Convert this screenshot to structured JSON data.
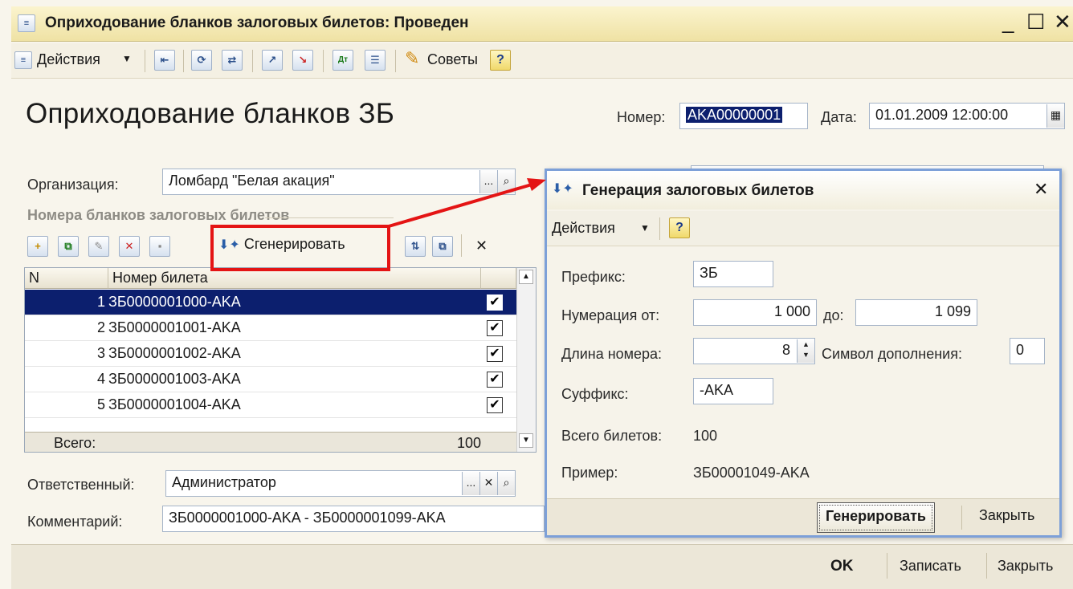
{
  "window": {
    "title": "Оприходование бланков залоговых билетов: Проведен",
    "minimize": "_",
    "maximize": "☐",
    "close": "✕"
  },
  "toolbar": {
    "actions_label": "Действия",
    "tips_label": "Советы",
    "help_label": "?"
  },
  "document": {
    "heading": "Оприходование бланков ЗБ",
    "number_label": "Номер:",
    "number_value": "AKA00000001",
    "date_label": "Дата:",
    "date_value": "01.01.2009 12:00:00",
    "org_label": "Организация:",
    "org_value": "Ломбард \"Белая акация\"",
    "group_title": "Номера бланков залоговых билетов",
    "generate_label": "Сгенерировать",
    "responsible_label": "Ответственный:",
    "responsible_value": "Администратор",
    "comment_label": "Комментарий:",
    "comment_value": "ЗБ0000001000-AKA - ЗБ0000001099-AKA"
  },
  "table": {
    "col_n": "N",
    "col_number": "Номер билета",
    "rows": [
      {
        "n": "1",
        "number": "ЗБ0000001000-AKA",
        "check": "✔"
      },
      {
        "n": "2",
        "number": "ЗБ0000001001-AKA",
        "check": "✔"
      },
      {
        "n": "3",
        "number": "ЗБ0000001002-AKA",
        "check": "✔"
      },
      {
        "n": "4",
        "number": "ЗБ0000001003-AKA",
        "check": "✔"
      },
      {
        "n": "5",
        "number": "ЗБ0000001004-AKA",
        "check": "✔"
      }
    ],
    "total_label": "Всего:",
    "total_value": "100"
  },
  "footer": {
    "ok": "OK",
    "save": "Записать",
    "close": "Закрыть"
  },
  "dialog": {
    "title": "Генерация залоговых билетов",
    "close": "✕",
    "actions_label": "Действия",
    "help_label": "?",
    "prefix_label": "Префикс:",
    "prefix_value": "ЗБ",
    "from_label": "Нумерация от:",
    "from_value": "1 000",
    "to_label": "до:",
    "to_value": "1 099",
    "length_label": "Длина номера:",
    "length_value": "8",
    "pad_label": "Символ дополнения:",
    "pad_value": "0",
    "suffix_label": "Суффикс:",
    "suffix_value": "-AKA",
    "total_label": "Всего билетов:",
    "total_value": "100",
    "example_label": "Пример:",
    "example_value": "ЗБ00001049-AKA",
    "generate_button": "Генерировать",
    "close_button": "Закрыть"
  },
  "colors": {
    "selection": "#0c1f6e",
    "annotation": "#e41414",
    "dialog_border": "#7da0d8"
  }
}
